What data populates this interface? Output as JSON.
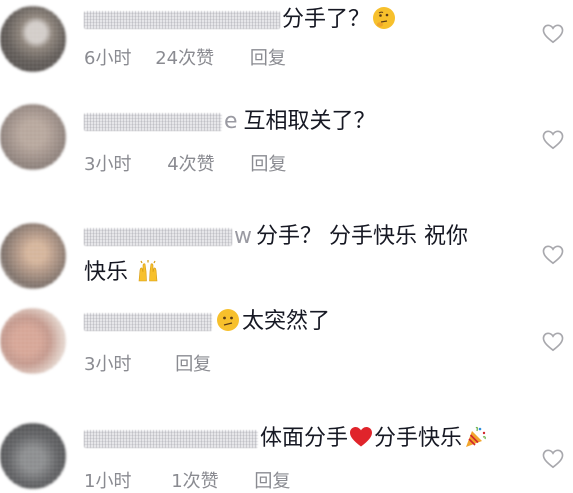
{
  "comments": [
    {
      "name_tail": "",
      "content": "分手了？",
      "emoji": "thinking-face-icon",
      "time": "6小时",
      "likes": "24次赞",
      "reply": "回复"
    },
    {
      "name_tail": "e",
      "content": "互相取关了？",
      "time": "3小时",
      "likes": "4次赞",
      "reply": "回复"
    },
    {
      "name_tail": "w",
      "content_line1": "分手？ 分手快乐 祝你",
      "content_line2": "快乐",
      "emoji": "raising-hands-icon"
    },
    {
      "content": "太突然了",
      "emoji": "confused-face-icon",
      "time": "3小时",
      "reply": "回复"
    },
    {
      "content_a": "体面分手",
      "content_b": "分手快乐",
      "emoji_a": "red-heart-icon",
      "emoji_b": "party-popper-icon",
      "time": "1小时",
      "likes": "1次赞",
      "reply": "回复"
    }
  ],
  "colors": {
    "text": "#161823",
    "meta": "#8a8b91",
    "heart_outline": "#a8a8ad",
    "red_heart": "#e0242b"
  },
  "icons": {
    "like": "heart-outline-icon"
  }
}
